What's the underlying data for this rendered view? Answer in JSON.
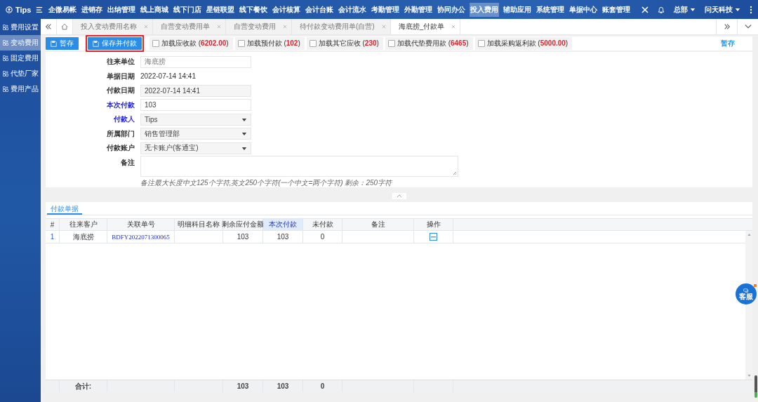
{
  "top_nav": {
    "brand": "Tips",
    "items": [
      {
        "label": "企微易帐",
        "selected": false
      },
      {
        "label": "进销存",
        "selected": false
      },
      {
        "label": "出纳管理",
        "selected": false
      },
      {
        "label": "线上商城",
        "selected": false
      },
      {
        "label": "线下门店",
        "selected": false
      },
      {
        "label": "星链联盟",
        "selected": false
      },
      {
        "label": "线下餐饮",
        "selected": false
      },
      {
        "label": "会计核算",
        "selected": false
      },
      {
        "label": "会计台账",
        "selected": false
      },
      {
        "label": "会计流水",
        "selected": false
      },
      {
        "label": "考勤管理",
        "selected": false
      },
      {
        "label": "外勤管理",
        "selected": false
      },
      {
        "label": "协同办公",
        "selected": false
      },
      {
        "label": "投入费用",
        "selected": true
      },
      {
        "label": "辅助应用",
        "selected": false
      },
      {
        "label": "系统管理",
        "selected": false
      },
      {
        "label": "单据中心",
        "selected": false
      },
      {
        "label": "账套管理",
        "selected": false
      }
    ],
    "menus": [
      "总部",
      "问天科技"
    ]
  },
  "sidebar": {
    "items": [
      {
        "label": "费用设置",
        "selected": false
      },
      {
        "label": "变动费用",
        "selected": true
      },
      {
        "label": "固定费用",
        "selected": false
      },
      {
        "label": "代垫厂家",
        "selected": false
      },
      {
        "label": "费用产品",
        "selected": false
      }
    ]
  },
  "tabs": [
    {
      "label": "投入变动费用名称",
      "selected": false
    },
    {
      "label": "自营变动费用单",
      "selected": false
    },
    {
      "label": "自营变动费用",
      "selected": false
    },
    {
      "label": "待付款变动费用单(自营)",
      "selected": false
    },
    {
      "label": "海底捞_付款单",
      "selected": true
    }
  ],
  "toolbar": {
    "buttons": [
      {
        "label": "暂存",
        "highlighted": false
      },
      {
        "label": "保存并付款",
        "highlighted": true
      }
    ],
    "loaders": [
      {
        "label": "加载应收款 (",
        "amount": "6202.00",
        "close": ")",
        "checked": false
      },
      {
        "label": "加载预付款 (",
        "amount": "102",
        "close": ")",
        "checked": false
      },
      {
        "label": "加载其它应收 (",
        "amount": "230",
        "close": ")",
        "checked": false
      },
      {
        "label": "加载代垫费用款 (",
        "amount": "6465",
        "close": ")",
        "checked": false
      },
      {
        "label": "加载采购返利款 (",
        "amount": "5000.00",
        "close": ")",
        "checked": false
      }
    ],
    "link": "暂存"
  },
  "form": {
    "fields": [
      {
        "label": "往来单位",
        "kind": "disabled",
        "value": "海底捞",
        "required": false
      },
      {
        "label": "单据日期",
        "kind": "text",
        "value": "2022-07-14 14:41",
        "required": false
      },
      {
        "label": "付款日期",
        "kind": "readonly",
        "value": "2022-07-14 14:41",
        "required": false
      },
      {
        "label": "本次付款",
        "kind": "input",
        "value": "103",
        "required": true
      },
      {
        "label": "付款人",
        "kind": "select",
        "value": "Tips",
        "required": true
      },
      {
        "label": "所属部门",
        "kind": "select",
        "value": "销售管理部",
        "required": false
      },
      {
        "label": "付款账户",
        "kind": "select",
        "value": "无卡账户(客通宝)",
        "required": false
      },
      {
        "label": "备注",
        "kind": "textarea",
        "required": false
      }
    ],
    "hint": "备注最大长度中文125个字符,英文250个字符(一个中文=两个字符) 剩余：250字符"
  },
  "payment_table": {
    "tab": "付款单据",
    "columns": [
      {
        "label": "#",
        "highlighted": false
      },
      {
        "label": "往来客户",
        "highlighted": false
      },
      {
        "label": "关联单号",
        "highlighted": false
      },
      {
        "label": "明细科目名称",
        "highlighted": false
      },
      {
        "label": "剩余应付金额",
        "highlighted": false
      },
      {
        "label": "本次付款",
        "highlighted": true
      },
      {
        "label": "未付款",
        "highlighted": false
      },
      {
        "label": "备注",
        "highlighted": false
      },
      {
        "label": "操作",
        "highlighted": false
      }
    ],
    "rows": [
      {
        "index": "1",
        "customer": "海底捞",
        "ref_no": "BDFY2022071300065",
        "remaining": "103",
        "this_payment": "103",
        "unpaid": "0"
      }
    ],
    "footer": {
      "customer": "合计:",
      "remaining": "103",
      "this_payment": "103",
      "unpaid": "0"
    }
  },
  "chat_button": {
    "label": "客服",
    "unread": true
  }
}
